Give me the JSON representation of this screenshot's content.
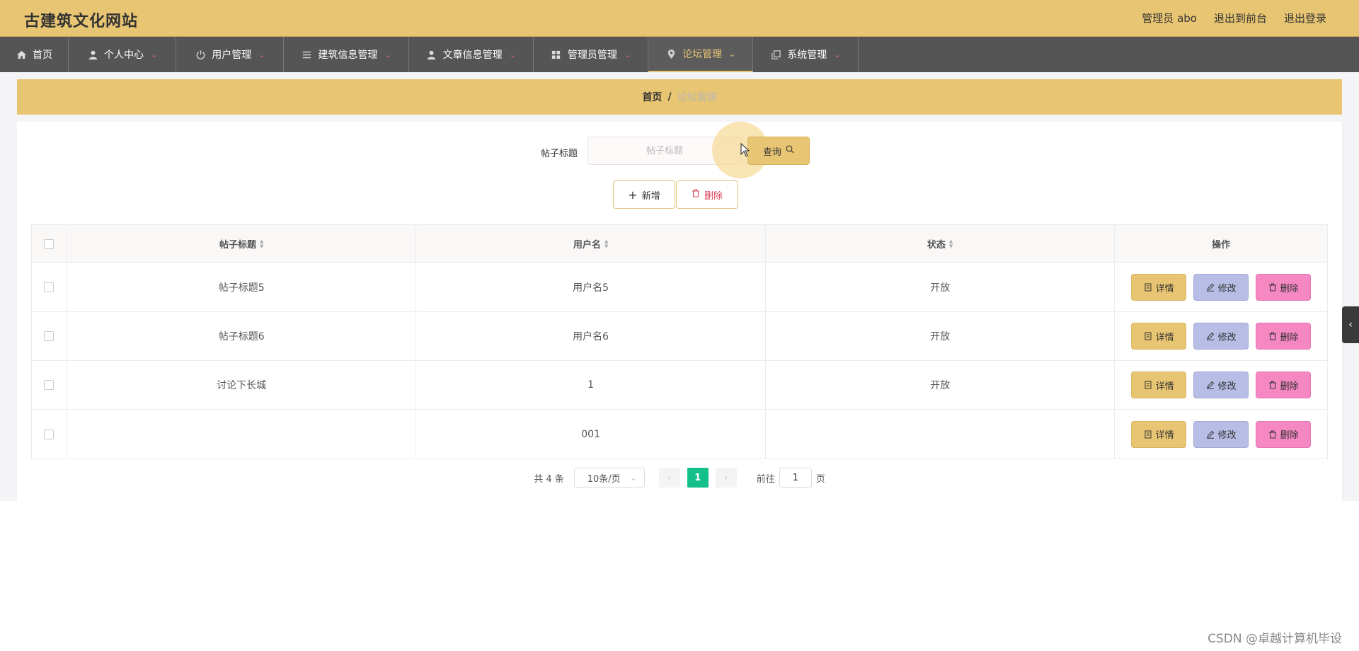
{
  "header": {
    "site_title": "古建筑文化网站",
    "admin_label": "管理员 abo",
    "exit_front": "退出到前台",
    "logout": "退出登录"
  },
  "nav": {
    "items": [
      {
        "label": "首页",
        "icon": "home-icon"
      },
      {
        "label": "个人中心",
        "icon": "user-icon"
      },
      {
        "label": "用户管理",
        "icon": "power-icon"
      },
      {
        "label": "建筑信息管理",
        "icon": "list-icon"
      },
      {
        "label": "文章信息管理",
        "icon": "user-icon"
      },
      {
        "label": "管理员管理",
        "icon": "grid-icon"
      },
      {
        "label": "论坛管理",
        "icon": "location-icon"
      },
      {
        "label": "系统管理",
        "icon": "copy-icon"
      }
    ],
    "active": "论坛管理"
  },
  "breadcrumb": {
    "home": "首页",
    "separator": "/",
    "current": "论坛管理"
  },
  "search": {
    "label": "帖子标题",
    "placeholder": "帖子标题",
    "button": "查询"
  },
  "actions": {
    "add": "新增",
    "delete": "删除"
  },
  "table": {
    "headers": [
      "帖子标题",
      "用户名",
      "状态",
      "操作"
    ],
    "rows": [
      {
        "title": "帖子标题5",
        "user": "用户名5",
        "status": "开放"
      },
      {
        "title": "帖子标题6",
        "user": "用户名6",
        "status": "开放"
      },
      {
        "title": "讨论下长城",
        "user": "1",
        "status": "开放"
      },
      {
        "title": "",
        "user": "001",
        "status": ""
      }
    ],
    "ops": {
      "detail": "详情",
      "edit": "修改",
      "delete": "删除"
    }
  },
  "pagination": {
    "total": "共 4 条",
    "page_size": "10条/页",
    "current_page": "1",
    "goto_label": "前往",
    "goto_value": "1",
    "page_suffix": "页"
  },
  "colors": {
    "accent": "#e8c572",
    "nav_bg": "#555555",
    "page_active": "#13c08a",
    "edit_btn": "#b8bde6",
    "delete_btn": "#f587c3"
  },
  "watermark": "CSDN @卓越计算机毕设"
}
